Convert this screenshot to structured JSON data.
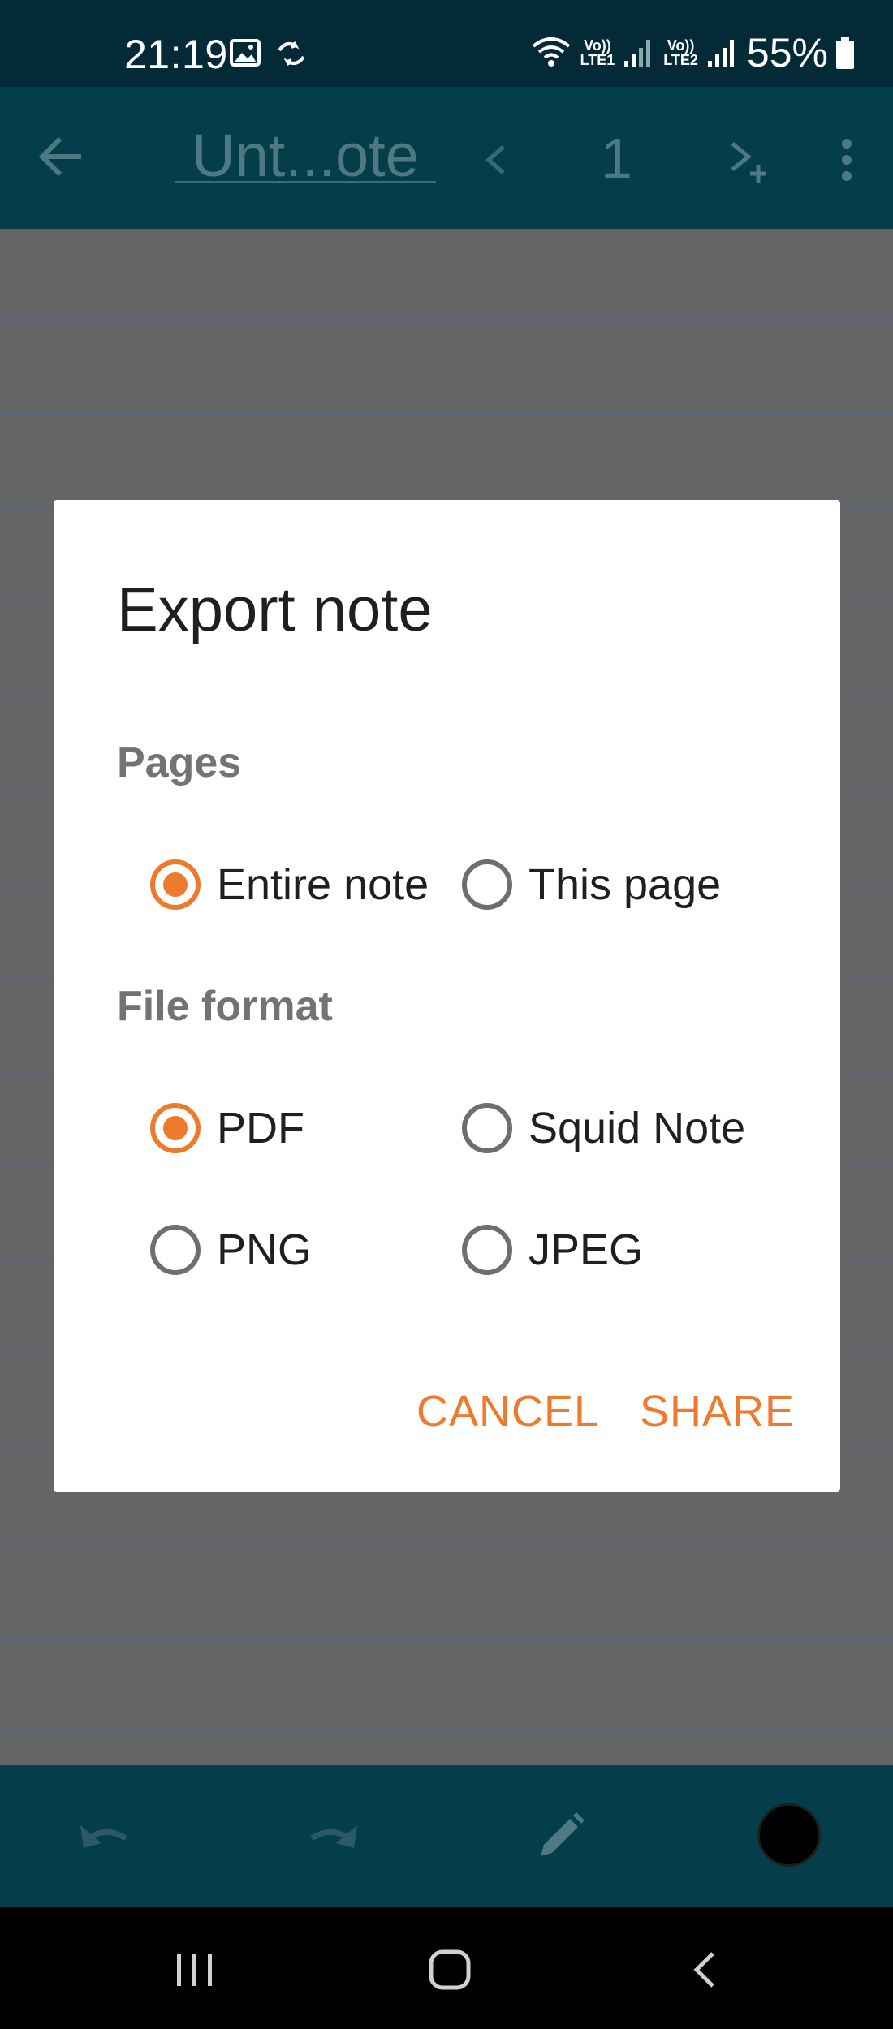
{
  "status_bar": {
    "time": "21:19",
    "sim1_label_top": "Vo))",
    "sim1_label_bottom": "LTE1",
    "sim2_label_top": "Vo))",
    "sim2_label_bottom": "LTE2",
    "battery": "55%"
  },
  "app_bar": {
    "note_title": "Unt...ote",
    "page_number": "1"
  },
  "dialog": {
    "title": "Export note",
    "pages_label": "Pages",
    "pages_options": [
      {
        "label": "Entire note",
        "checked": true
      },
      {
        "label": "This page",
        "checked": false
      }
    ],
    "format_label": "File format",
    "format_options": [
      {
        "label": "PDF",
        "checked": true
      },
      {
        "label": "Squid Note",
        "checked": false
      },
      {
        "label": "PNG",
        "checked": false
      },
      {
        "label": "JPEG",
        "checked": false
      }
    ],
    "cancel_label": "CANCEL",
    "share_label": "SHARE"
  },
  "colors": {
    "accent": "#ee7a2d",
    "app_bar": "#053e4b",
    "scrim_canvas": "#656565"
  }
}
